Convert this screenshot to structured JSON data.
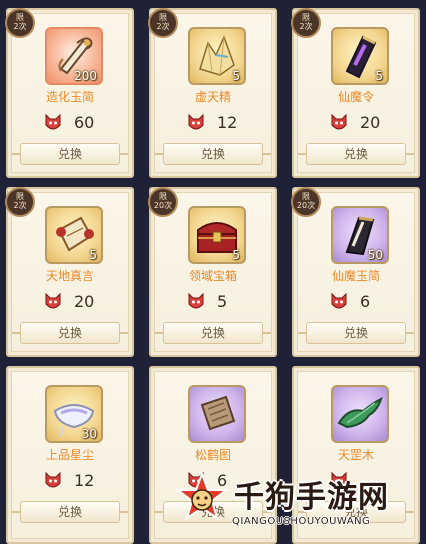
{
  "shop": {
    "items": [
      {
        "name": "造化玉简",
        "qty": "200",
        "price": "60",
        "button": "兑换",
        "badge_a": "限",
        "badge_b": "2次",
        "icon": "jade-scroll-icon",
        "bg": "orange"
      },
      {
        "name": "虚天精",
        "qty": "5",
        "price": "12",
        "button": "兑换",
        "badge_a": "限",
        "badge_b": "2次",
        "icon": "crystal-icon",
        "bg": "gold"
      },
      {
        "name": "仙魔令",
        "qty": "5",
        "price": "20",
        "button": "兑换",
        "badge_a": "限",
        "badge_b": "2次",
        "icon": "token-icon",
        "bg": "gold"
      },
      {
        "name": "天地真言",
        "qty": "5",
        "price": "20",
        "button": "兑换",
        "badge_a": "限",
        "badge_b": "2次",
        "icon": "scroll-icon",
        "bg": "gold"
      },
      {
        "name": "领域宝箱",
        "qty": "5",
        "price": "5",
        "button": "兑换",
        "badge_a": "限",
        "badge_b": "20次",
        "icon": "treasure-chest-icon",
        "bg": "gold"
      },
      {
        "name": "仙魔玉简",
        "qty": "50",
        "price": "6",
        "button": "兑换",
        "badge_a": "限",
        "badge_b": "20次",
        "icon": "dark-jade-icon",
        "bg": "purple"
      },
      {
        "name": "上品星尘",
        "qty": "30",
        "price": "12",
        "button": "兑换",
        "icon": "stardust-icon",
        "bg": "gold"
      },
      {
        "name": "松鹤图",
        "qty": "",
        "price": "6",
        "button": "兑换",
        "icon": "painting-scroll-icon",
        "bg": "purple"
      },
      {
        "name": "天罡木",
        "qty": "",
        "price": "",
        "button": "兑换",
        "icon": "green-wood-icon",
        "bg": "purple"
      }
    ]
  },
  "watermark": {
    "title": "千狗手游网",
    "subtitle": "QIANGOUSHOUYOUWANG"
  }
}
